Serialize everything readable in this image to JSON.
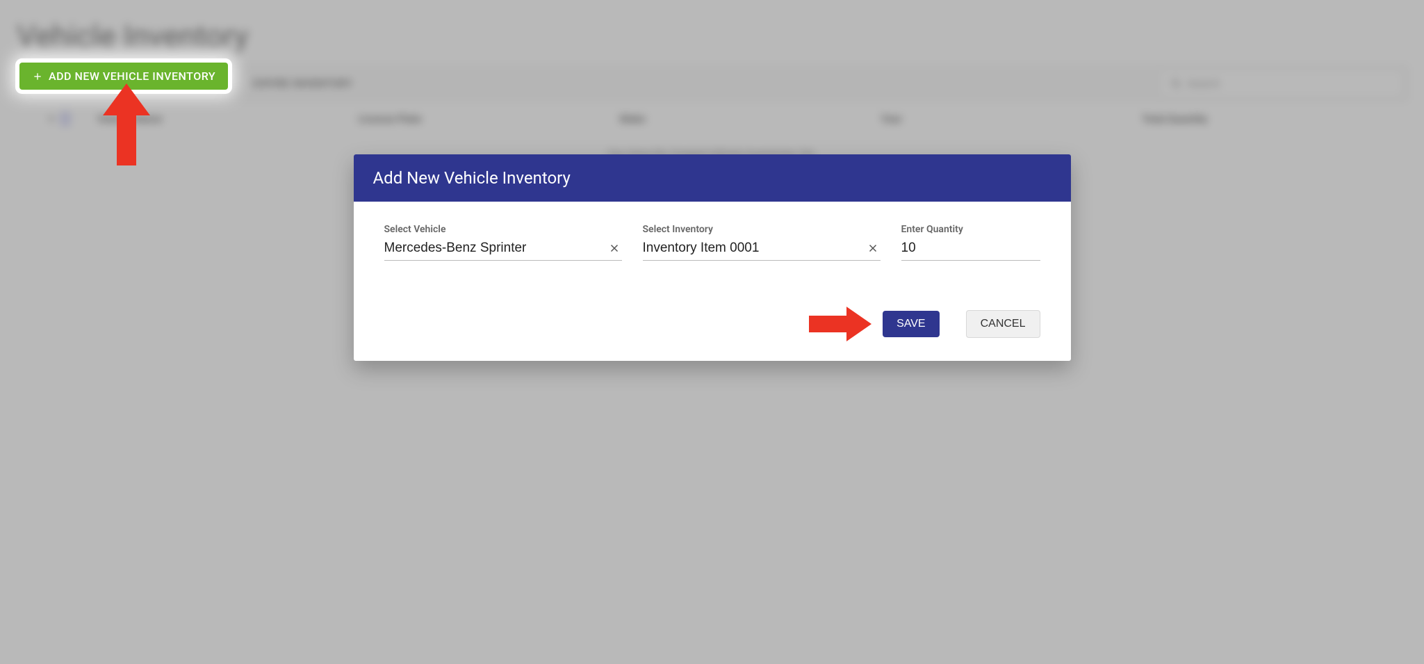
{
  "page": {
    "title": "Vehicle Inventory",
    "add_button_label": "ADD NEW VEHICLE INVENTORY",
    "expire_button_label": "EXPIRE INVENTORY",
    "search_placeholder": "Search",
    "empty_message": "You Have No Created Vehicle Inventories Yet.",
    "columns": {
      "vehicle_name": "Vehicle Name",
      "license_plate": "License Plate",
      "make": "Make",
      "year": "Year",
      "total_quantity": "Total Quantity"
    }
  },
  "modal": {
    "title": "Add New Vehicle Inventory",
    "fields": {
      "vehicle": {
        "label": "Select Vehicle",
        "value": "Mercedes-Benz Sprinter"
      },
      "inventory": {
        "label": "Select Inventory",
        "value": "Inventory Item 0001"
      },
      "quantity": {
        "label": "Enter Quantity",
        "value": "10"
      }
    },
    "actions": {
      "save": "SAVE",
      "cancel": "CANCEL"
    }
  },
  "colors": {
    "primary": "#2f368f",
    "accent_green": "#6ab42d",
    "annotation_red": "#eb3323"
  }
}
